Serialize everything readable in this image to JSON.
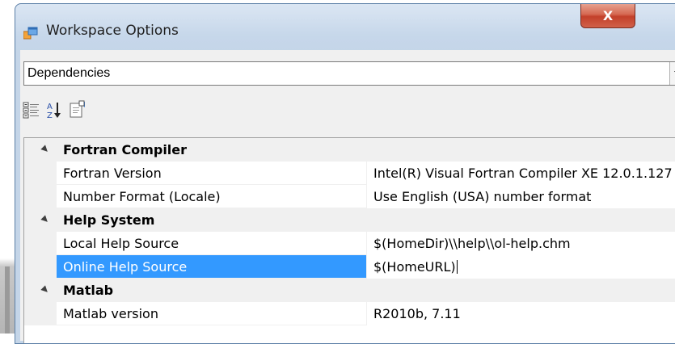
{
  "window": {
    "title": "Workspace Options",
    "close_label": "X"
  },
  "dropdown": {
    "value": "Dependencies"
  },
  "toolbar": {
    "icons": [
      "categorized-icon",
      "alphabetical-sort-icon",
      "property-pages-icon"
    ]
  },
  "grid": {
    "categories": [
      {
        "label": "Fortran Compiler",
        "properties": [
          {
            "name": "Fortran Version",
            "value": "Intel(R) Visual Fortran Compiler XE 12.0.1.127"
          },
          {
            "name": "Number Format (Locale)",
            "value": "Use English (USA) number format"
          }
        ]
      },
      {
        "label": "Help System",
        "properties": [
          {
            "name": "Local Help Source",
            "value": "$(HomeDir)\\\\help\\\\ol-help.chm"
          },
          {
            "name": "Online Help Source",
            "value": "$(HomeURL)"
          }
        ]
      },
      {
        "label": "Matlab",
        "properties": [
          {
            "name": "Matlab version",
            "value": "R2010b, 7.11"
          }
        ]
      }
    ],
    "selected_property": "Online Help Source"
  },
  "colors": {
    "selection": "#3399ff",
    "category_bg": "#f0f0f0",
    "close_button": "#c3402a"
  }
}
